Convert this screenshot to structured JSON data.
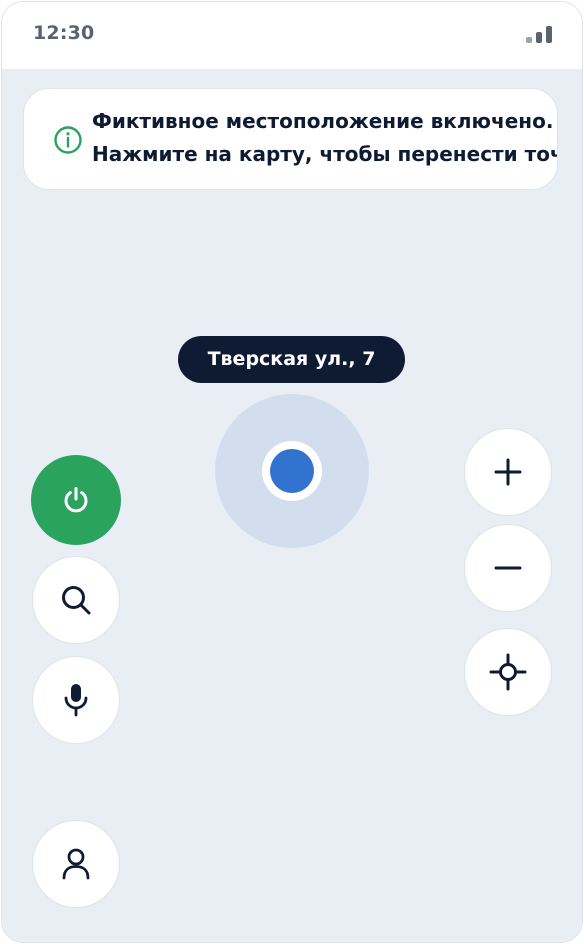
{
  "status_bar": {
    "time": "12:30",
    "signal_icon": "signal-bars-icon"
  },
  "banner": {
    "icon": "info-icon",
    "line1": "Фиктивное местоположение включено.",
    "line2": "Нажмите на карту, чтобы перенести точку"
  },
  "map": {
    "location_label": "Тверская ул., 7"
  },
  "controls": {
    "left": [
      "power-icon",
      "search-icon",
      "microphone-icon",
      "profile-icon"
    ],
    "right": [
      "plus-icon",
      "minus-icon",
      "crosshair-icon"
    ]
  },
  "colors": {
    "map_background": "#e8eef4",
    "accent_green": "#2aa35e",
    "location_blue": "#3373d0",
    "accuracy_halo": "#d2deee",
    "dark_navy": "#0f1b33",
    "status_text": "#5a6270"
  }
}
